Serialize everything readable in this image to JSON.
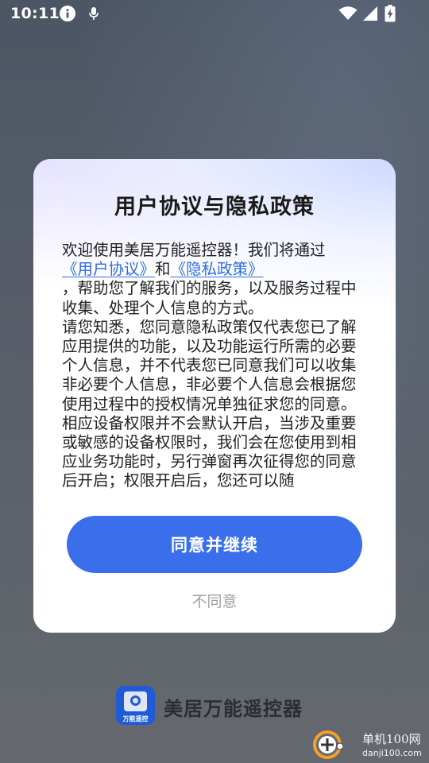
{
  "status_bar": {
    "time": "10:11",
    "icons": [
      "info-icon",
      "microphone-icon",
      "wifi-icon",
      "signal-icon",
      "battery-charging-icon"
    ]
  },
  "dialog": {
    "title": "用户协议与隐私政策",
    "intro_prefix": "欢迎使用美居万能遥控器！我们将通过",
    "user_agreement_link": "《用户协议》",
    "conjunction": "和",
    "privacy_policy_link": "《隐私政策》",
    "intro_suffix": "，帮助您了解我们的服务，以及服务过程中收集、处理个人信息的方式。",
    "paragraph2": "请您知悉，您同意隐私政策仅代表您已了解应用提供的功能，以及功能运行所需的必要个人信息，并不代表您已同意我们可以收集非必要个人信息，非必要个人信息会根据您使用过程中的授权情况单独征求您的同意。",
    "paragraph3": "相应设备权限并不会默认开启，当涉及重要或敏感的设备权限时，我们会在您使用到相应业务功能时，另行弹窗再次征得您的同意后开启；权限开启后，您还可以随",
    "agree_button": "同意并继续",
    "disagree_button": "不同意"
  },
  "brand": {
    "logo_text": "万能遥控",
    "name": "美居万能遥控器"
  },
  "watermark": {
    "title": "单机100网",
    "url": "danji100.com"
  },
  "colors": {
    "accent": "#3a6eea",
    "link": "#2f6ce5",
    "brand_logo": "#1f5bd6"
  }
}
